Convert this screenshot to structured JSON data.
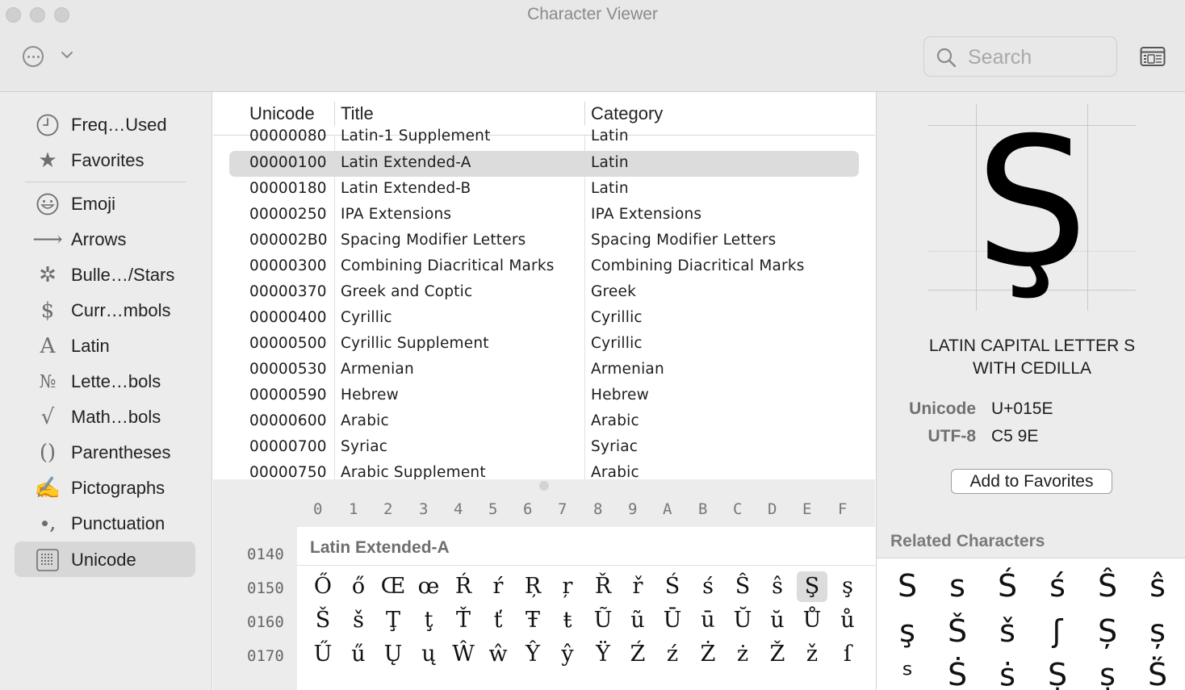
{
  "window": {
    "title": "Character Viewer"
  },
  "toolbar": {
    "search_placeholder": "Search"
  },
  "sidebar": {
    "items": [
      {
        "label": "Freq…Used",
        "icon": "clock-icon",
        "glyph": ""
      },
      {
        "label": "Favorites",
        "icon": "star-icon",
        "glyph": "★"
      },
      {
        "label": "Emoji",
        "icon": "smiley-icon",
        "glyph": ""
      },
      {
        "label": "Arrows",
        "icon": "arrow-icon",
        "glyph": "⟶"
      },
      {
        "label": "Bulle…/Stars",
        "icon": "asterisk-icon",
        "glyph": "✲"
      },
      {
        "label": "Curr…mbols",
        "icon": "dollar-icon",
        "glyph": "$"
      },
      {
        "label": "Latin",
        "icon": "latin-a-icon",
        "glyph": "A"
      },
      {
        "label": "Lette…bols",
        "icon": "numero-icon",
        "glyph": "№"
      },
      {
        "label": "Math…bols",
        "icon": "sqrt-icon",
        "glyph": "√"
      },
      {
        "label": "Parentheses",
        "icon": "parentheses-icon",
        "glyph": "()"
      },
      {
        "label": "Pictographs",
        "icon": "writing-hand-icon",
        "glyph": "✍"
      },
      {
        "label": "Punctuation",
        "icon": "punctuation-icon",
        "glyph": "•,"
      },
      {
        "label": "Unicode",
        "icon": "unicode-grid-icon",
        "glyph": ""
      }
    ],
    "selected": "Unicode"
  },
  "table": {
    "headers": {
      "unicode": "Unicode",
      "title": "Title",
      "category": "Category"
    },
    "rows": [
      {
        "code": "00000080",
        "title": "Latin-1 Supplement",
        "category": "Latin"
      },
      {
        "code": "00000100",
        "title": "Latin Extended-A",
        "category": "Latin",
        "selected": true
      },
      {
        "code": "00000180",
        "title": "Latin Extended-B",
        "category": "Latin"
      },
      {
        "code": "00000250",
        "title": "IPA Extensions",
        "category": "IPA Extensions"
      },
      {
        "code": "000002B0",
        "title": "Spacing Modifier Letters",
        "category": "Spacing Modifier Letters"
      },
      {
        "code": "00000300",
        "title": "Combining Diacritical Marks",
        "category": "Combining Diacritical Marks"
      },
      {
        "code": "00000370",
        "title": "Greek and Coptic",
        "category": "Greek"
      },
      {
        "code": "00000400",
        "title": "Cyrillic",
        "category": "Cyrillic"
      },
      {
        "code": "00000500",
        "title": "Cyrillic Supplement",
        "category": "Cyrillic"
      },
      {
        "code": "00000530",
        "title": "Armenian",
        "category": "Armenian"
      },
      {
        "code": "00000590",
        "title": "Hebrew",
        "category": "Hebrew"
      },
      {
        "code": "00000600",
        "title": "Arabic",
        "category": "Arabic"
      },
      {
        "code": "00000700",
        "title": "Syriac",
        "category": "Syriac"
      },
      {
        "code": "00000750",
        "title": "Arabic Supplement",
        "category": "Arabic"
      }
    ]
  },
  "grid": {
    "columns": [
      "0",
      "1",
      "2",
      "3",
      "4",
      "5",
      "6",
      "7",
      "8",
      "9",
      "A",
      "B",
      "C",
      "D",
      "E",
      "F"
    ],
    "block_title": "Latin Extended-A",
    "row_labels": [
      "0140",
      "0150",
      "0160",
      "0170"
    ],
    "rows": [
      [
        "Ő",
        "ő",
        "Œ",
        "œ",
        "Ŕ",
        "ŕ",
        "Ŗ",
        "ŗ",
        "Ř",
        "ř",
        "Ś",
        "ś",
        "Ŝ",
        "ŝ",
        "Ş",
        "ş"
      ],
      [
        "Š",
        "š",
        "Ţ",
        "ţ",
        "Ť",
        "ť",
        "Ŧ",
        "ŧ",
        "Ũ",
        "ũ",
        "Ū",
        "ū",
        "Ŭ",
        "ŭ",
        "Ů",
        "ů"
      ],
      [
        "Ű",
        "ű",
        "Ų",
        "ų",
        "Ŵ",
        "ŵ",
        "Ŷ",
        "ŷ",
        "Ÿ",
        "Ź",
        "ź",
        "Ż",
        "ż",
        "Ž",
        "ž",
        "ſ"
      ]
    ],
    "selected_char": "Ş"
  },
  "detail": {
    "glyph": "Ş",
    "name_line1": "LATIN CAPITAL LETTER S",
    "name_line2": "WITH CEDILLA",
    "unicode_label": "Unicode",
    "unicode_value": "U+015E",
    "utf8_label": "UTF-8",
    "utf8_value": "C5 9E",
    "favorites_button": "Add to Favorites",
    "related_title": "Related Characters",
    "related": [
      [
        "S",
        "s",
        "Ś",
        "ś",
        "Ŝ",
        "ŝ"
      ],
      [
        "ş",
        "Š",
        "š",
        "ʃ",
        "Ș",
        "ș"
      ],
      [
        "ˢ",
        "Ṡ",
        "ṡ",
        "Ṣ",
        "ṣ",
        "Ṥ"
      ]
    ]
  },
  "colors": {
    "selection": "#dcdcdc",
    "sidebar_bg": "#ececec",
    "toolbar_bg": "#e8e8e8"
  }
}
